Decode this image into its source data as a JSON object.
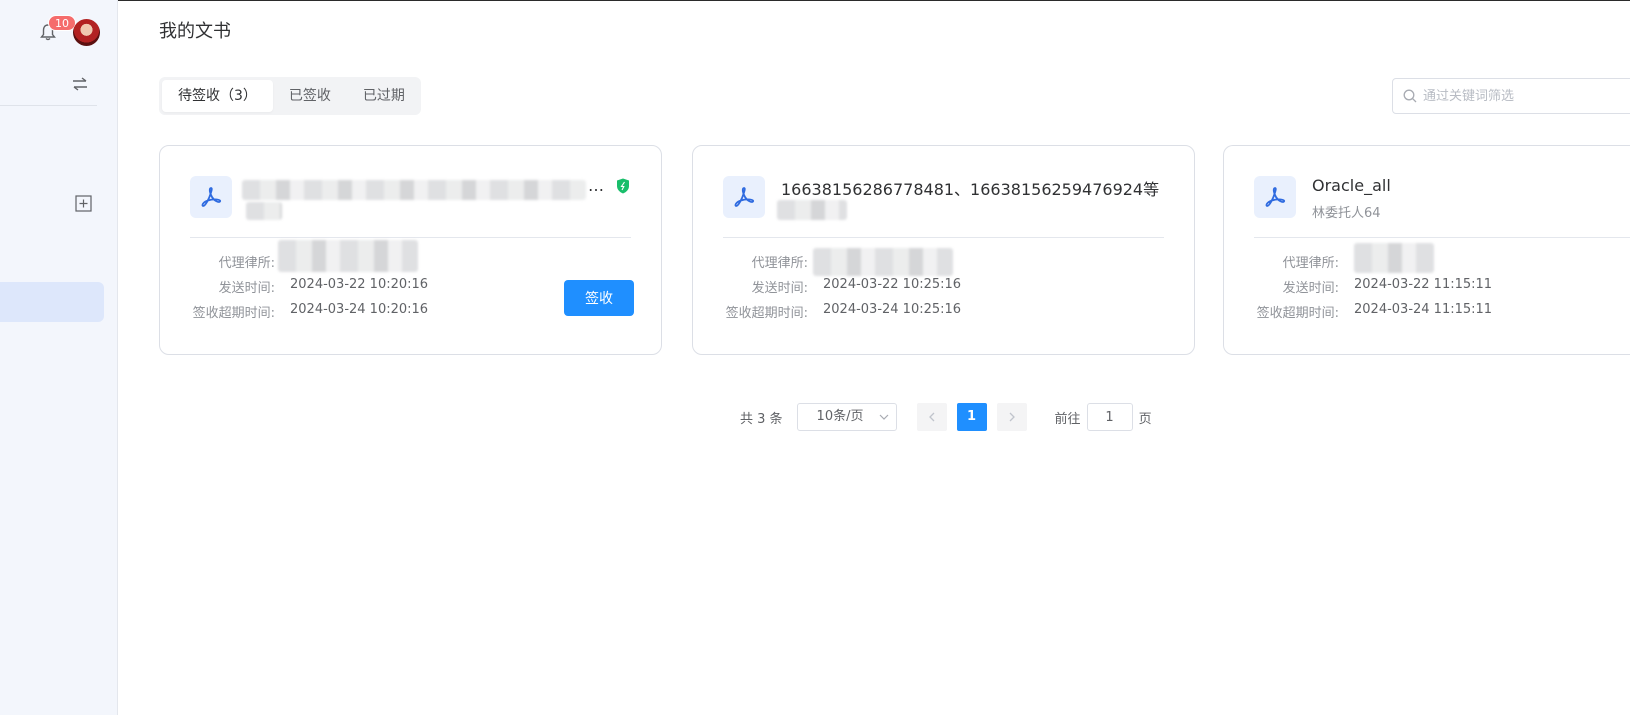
{
  "header": {
    "page_title": "我的文书"
  },
  "sidebar": {
    "notification_count": "10"
  },
  "tabs": [
    {
      "label": "待签收（3）",
      "active": true
    },
    {
      "label": "已签收",
      "active": false
    },
    {
      "label": "已过期",
      "active": false
    }
  ],
  "search": {
    "placeholder": "通过关键词筛选",
    "value": ""
  },
  "cards": [
    {
      "title": "…",
      "subtitle": "",
      "fields": [
        {
          "label": "代理律所:",
          "value": ""
        },
        {
          "label": "发送时间:",
          "value": "2024-03-22 10:20:16"
        },
        {
          "label": "签收超期时间:",
          "value": "2024-03-24 10:20:16"
        }
      ],
      "action_label": "签收"
    },
    {
      "title": "16638156286778481、16638156259476924等",
      "subtitle": "",
      "fields": [
        {
          "label": "代理律所:",
          "value": ""
        },
        {
          "label": "发送时间:",
          "value": "2024-03-22 10:25:16"
        },
        {
          "label": "签收超期时间:",
          "value": "2024-03-24 10:25:16"
        }
      ]
    },
    {
      "title": "Oracle_all",
      "subtitle": "林委托人64",
      "fields": [
        {
          "label": "代理律所:",
          "value": ""
        },
        {
          "label": "发送时间:",
          "value": "2024-03-22 11:15:11"
        },
        {
          "label": "签收超期时间:",
          "value": "2024-03-24 11:15:11"
        }
      ]
    }
  ],
  "pagination": {
    "total_text": "共 3 条",
    "page_size": "10条/页",
    "current_page": "1",
    "goto_prefix": "前往",
    "goto_value": "1",
    "goto_suffix": "页"
  },
  "colors": {
    "primary": "#1f8fff",
    "badge": "#f56c6c",
    "shield": "#19be6b",
    "pdf_icon": "#2f6be0",
    "sidebar_bg": "#f3f6fc"
  }
}
